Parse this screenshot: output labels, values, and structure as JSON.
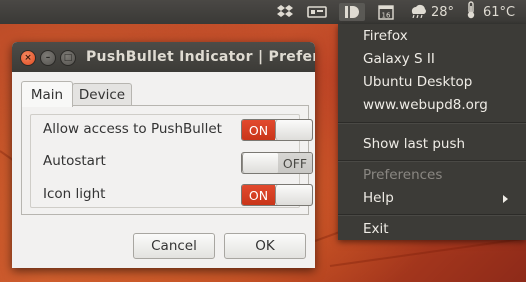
{
  "panel": {
    "tray": [
      {
        "icon": "dropbox-icon"
      },
      {
        "icon": "network-icon"
      },
      {
        "icon": "tweet-icon"
      },
      {
        "icon": "pushbullet-icon"
      },
      {
        "icon": "calendar-icon",
        "text": "16"
      },
      {
        "icon": "weather-icon",
        "text": "28°"
      },
      {
        "icon": "thermometer-icon",
        "text": "61°C"
      }
    ]
  },
  "menu": {
    "devices": [
      "Firefox",
      "Galaxy S II",
      "Ubuntu Desktop",
      "www.webupd8.org"
    ],
    "show_last_push": "Show last push",
    "preferences": "Preferences",
    "help": "Help",
    "exit": "Exit"
  },
  "window": {
    "title": "PushBullet Indicator | Preferen",
    "close_symbol": "×",
    "min_symbol": "–",
    "max_symbol": "□",
    "tabs": [
      "Main",
      "Device"
    ],
    "rows": [
      {
        "label": "Allow access to PushBullet",
        "state": "ON"
      },
      {
        "label": "Autostart",
        "state": "OFF"
      },
      {
        "label": "Icon light",
        "state": "ON"
      }
    ],
    "cancel_label": "Cancel",
    "ok_label": "OK"
  },
  "colors": {
    "panel_bg": "#3c3b37",
    "accent_on": "#d63d21",
    "close_button": "#df4a20"
  }
}
